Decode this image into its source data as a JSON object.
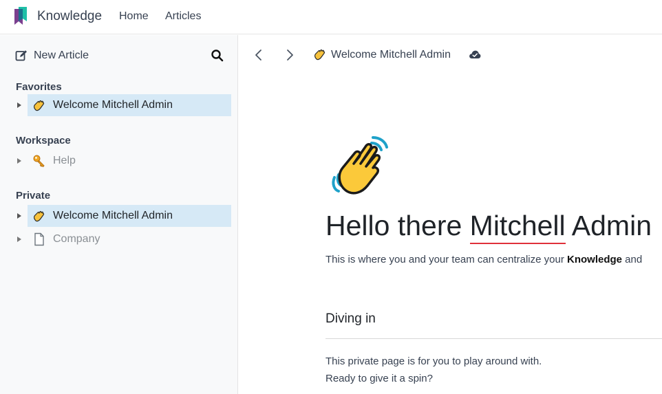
{
  "app": {
    "name": "Knowledge",
    "nav": {
      "home": "Home",
      "articles": "Articles"
    }
  },
  "sidebar": {
    "new_article_label": "New Article",
    "sections": {
      "favorites": "Favorites",
      "workspace": "Workspace",
      "private": "Private"
    },
    "favorites_items": [
      {
        "label": "Welcome Mitchell Admin",
        "icon": "waving-hand-icon",
        "active": true
      }
    ],
    "workspace_items": [
      {
        "label": "Help",
        "icon": "key-icon",
        "active": false
      }
    ],
    "private_items": [
      {
        "label": "Welcome Mitchell Admin",
        "icon": "waving-hand-icon",
        "active": true
      },
      {
        "label": "Company",
        "icon": "document-icon",
        "active": false
      }
    ]
  },
  "header": {
    "breadcrumb": "Welcome Mitchell Admin"
  },
  "article": {
    "title_prefix": "Hello there ",
    "title_name": "Mitchell",
    "title_suffix": " Admin",
    "intro_prefix": "This is where you and your team can centralize your ",
    "intro_bold": "Knowledge",
    "intro_suffix": " and",
    "section_heading": "Diving in",
    "paragraph_line1": "This private page is for you to play around with.",
    "paragraph_line2": "Ready to give it a spin?"
  },
  "colors": {
    "active_row": "#d6e9f6",
    "sidebar_bg": "#f8f9fa",
    "spell_underline": "#e0303a",
    "logo_teal": "#1fbfa7",
    "logo_purple": "#7b3f8f"
  }
}
